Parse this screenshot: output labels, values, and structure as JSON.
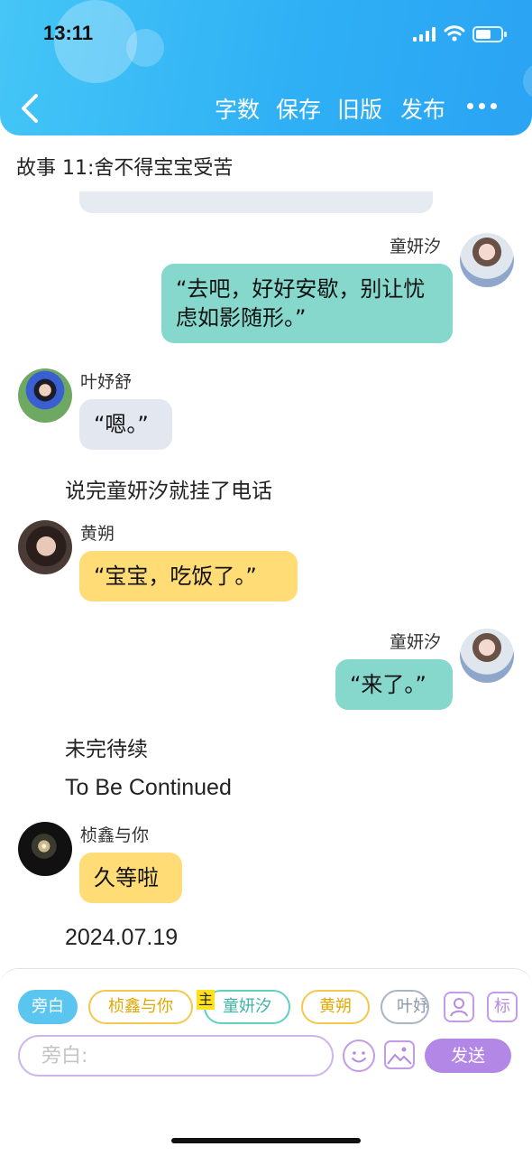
{
  "status_bar": {
    "time": "13:11"
  },
  "nav": {
    "word_count": "字数",
    "save": "保存",
    "old_version": "旧版",
    "publish": "发布"
  },
  "story_title": "故事 11:舍不得宝宝受苦",
  "messages": [
    {
      "speaker": "童妍汐",
      "text": "“去吧，好好安歇，别让忧虑如影随形。”",
      "side": "right",
      "color": "#86d8cd"
    },
    {
      "speaker": "叶妤舒",
      "text": "“嗯。”",
      "side": "left",
      "color": "#e3e8f0"
    },
    {
      "narration": "说完童妍汐就挂了电话"
    },
    {
      "speaker": "黄朔",
      "text": "“宝宝，吃饭了。”",
      "side": "left",
      "color": "#ffdc76"
    },
    {
      "speaker": "童妍汐",
      "text": "“来了。”",
      "side": "right",
      "color": "#86d8cd"
    },
    {
      "narration": "未完待续"
    },
    {
      "narration": "To Be Continued"
    },
    {
      "speaker": "桢鑫与你",
      "text": "久等啦",
      "side": "left",
      "color": "#ffdc76"
    },
    {
      "narration": "2024.07.19"
    }
  ],
  "composer": {
    "chips": [
      "旁白",
      "桢鑫与你",
      "童妍汐",
      "黄朔",
      "叶妤"
    ],
    "main_mark": "主",
    "tag_label": "标",
    "placeholder": "旁白:",
    "send": "发送"
  },
  "colors": {
    "header": "#2fb0f5",
    "teal_bubble": "#86d8cd",
    "gray_bubble": "#e3e8f0",
    "yellow_bubble": "#ffdc76",
    "send_button": "#b287e6"
  }
}
